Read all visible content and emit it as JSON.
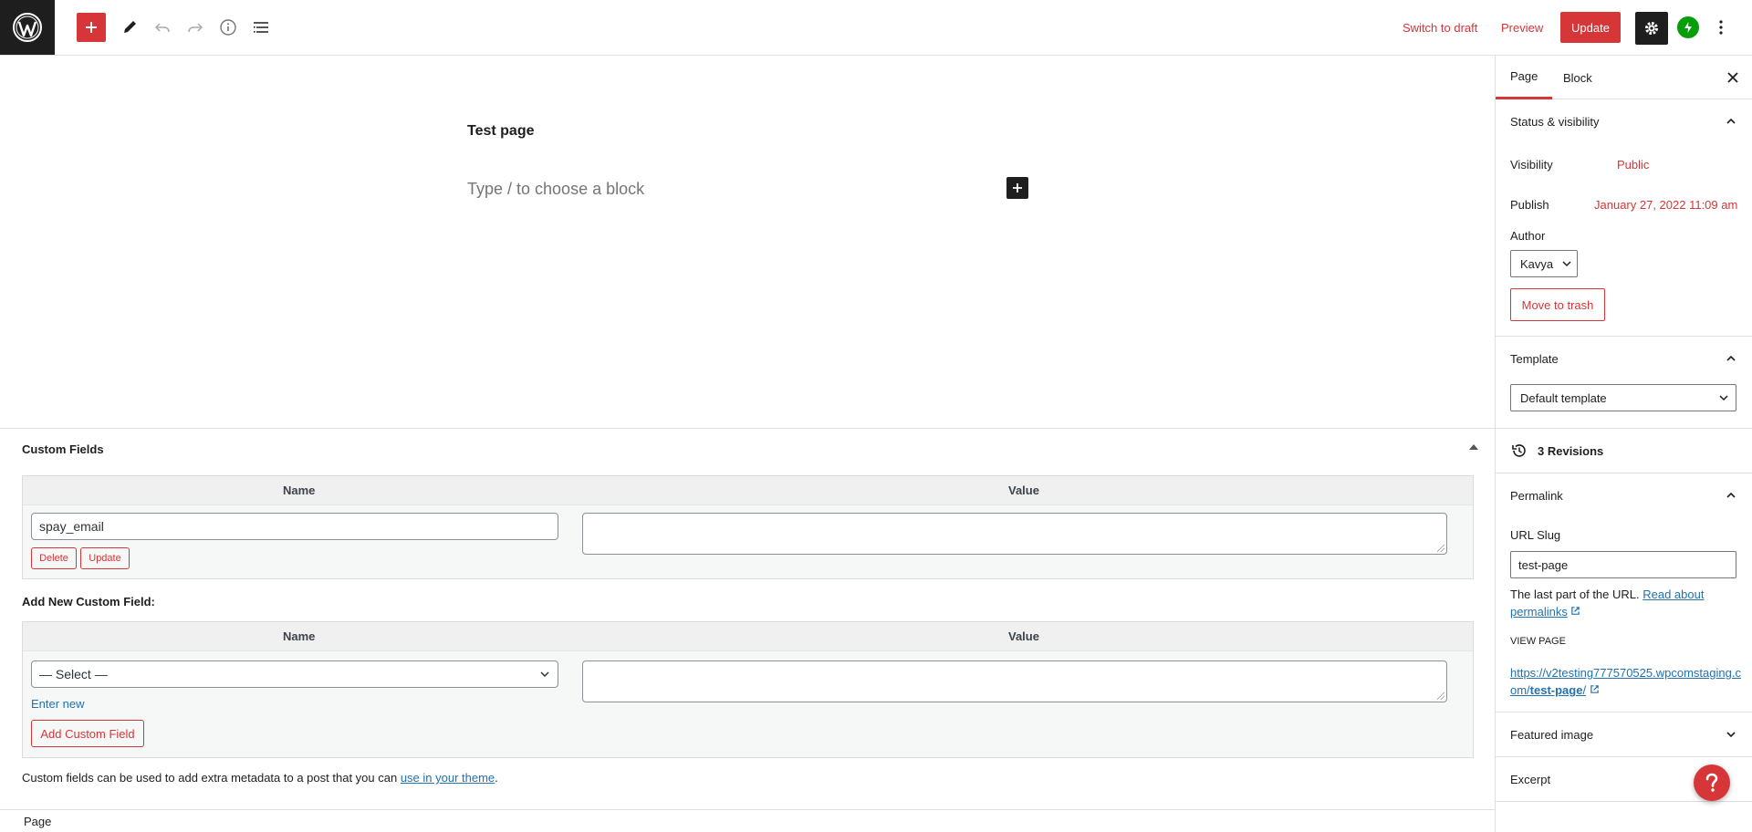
{
  "toolbar": {
    "add_block_label": "Add block",
    "switch_to_draft": "Switch to draft",
    "preview": "Preview",
    "update": "Update"
  },
  "editor": {
    "title": "Test page",
    "placeholder": "Type / to choose a block"
  },
  "custom_fields": {
    "title": "Custom Fields",
    "columns": [
      "Name",
      "Value"
    ],
    "existing": {
      "name": "spay_email",
      "value": "",
      "delete_label": "Delete",
      "update_label": "Update"
    },
    "add_new_label": "Add New Custom Field:",
    "select_value": "— Select —",
    "enter_new": "Enter new",
    "add_button": "Add Custom Field",
    "note_prefix": "Custom fields can be used to add extra metadata to a post that you can ",
    "note_link": "use in your theme",
    "note_suffix": "."
  },
  "footer": {
    "breadcrumb": "Page"
  },
  "sidebar": {
    "tabs": [
      "Page",
      "Block"
    ],
    "status_visibility": {
      "title": "Status & visibility",
      "visibility_label": "Visibility",
      "visibility_value": "Public",
      "publish_label": "Publish",
      "publish_value": "January 27, 2022 11:09 am",
      "author_label": "Author",
      "author_value": "Kavya",
      "trash_label": "Move to trash"
    },
    "template": {
      "title": "Template",
      "value": "Default template"
    },
    "revisions": "3 Revisions",
    "permalink": {
      "title": "Permalink",
      "slug_label": "URL Slug",
      "slug_value": "test-page",
      "help_text": "The last part of the URL. ",
      "help_link": "Read about permalinks",
      "view_page_label": "VIEW PAGE",
      "url_prefix": "https://v2testing777570525.wpcomstaging.com/",
      "url_slug": "test-page",
      "url_suffix": "/"
    },
    "featured_image": "Featured image",
    "excerpt": "Excerpt"
  },
  "colors": {
    "accent": "#d63638",
    "link": "#2271b1",
    "dark": "#1e1e1e",
    "jetpack": "#069e08"
  }
}
